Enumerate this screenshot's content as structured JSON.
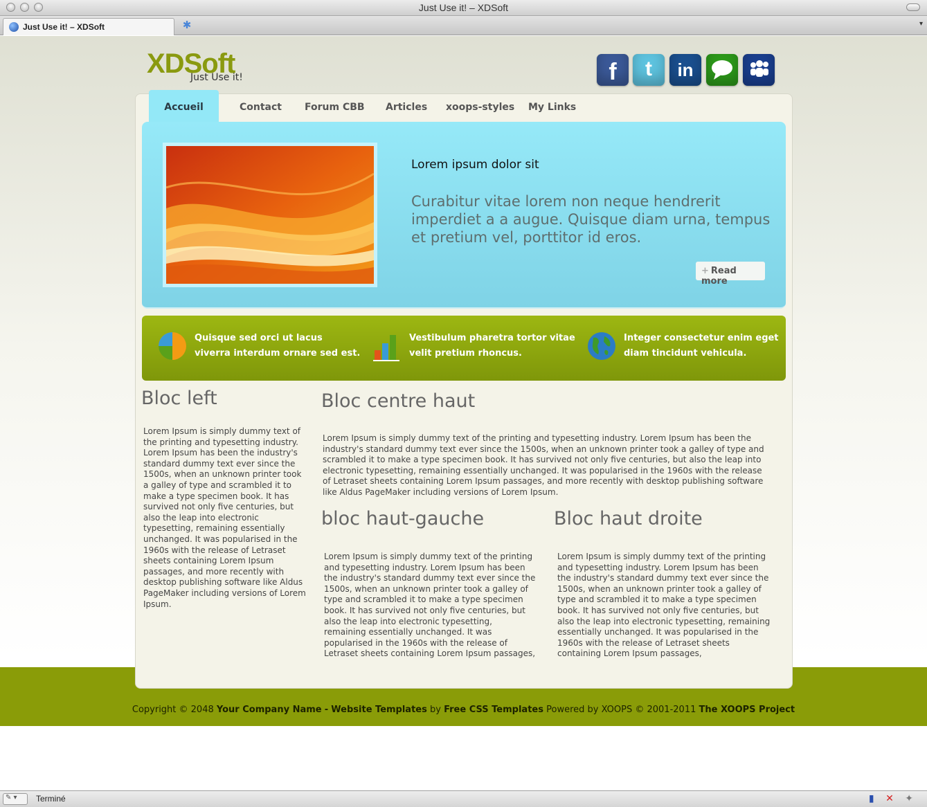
{
  "window": {
    "title": "Just Use it! – XDSoft",
    "tab_label": "Just Use it! – XDSoft"
  },
  "site": {
    "logo": "XDSoft",
    "tagline": "Just Use it!",
    "social": [
      {
        "name": "facebook",
        "glyph": "f",
        "color": "#3b5998"
      },
      {
        "name": "twitter",
        "glyph": "t",
        "color": "#5ec3df"
      },
      {
        "name": "linkedin",
        "glyph": "in",
        "color": "#1a4f8f"
      },
      {
        "name": "chat",
        "glyph": "",
        "color": "#2d9a1a"
      },
      {
        "name": "myspace",
        "glyph": "",
        "color": "#1a3f8f"
      }
    ]
  },
  "nav": {
    "items": [
      "Accueil",
      "Contact",
      "Forum CBB",
      "Articles",
      "xoops-styles",
      "My Links"
    ]
  },
  "hero": {
    "title": "Lorem ipsum dolor sit",
    "text": "Curabitur vitae lorem non neque hendrerit imperdiet a a augue. Quisque diam urna, tempus et pretium vel, porttitor id eros.",
    "read_more": "Read more"
  },
  "features": [
    {
      "icon": "pie-chart-icon",
      "text": "Quisque sed orci ut lacus viverra interdum ornare sed est."
    },
    {
      "icon": "bar-chart-icon",
      "text": "Vestibulum pharetra tortor vitae velit pretium rhoncus."
    },
    {
      "icon": "globe-icon",
      "text": "Integer consectetur enim eget diam tincidunt vehicula."
    }
  ],
  "blocks": {
    "left_title": "Bloc left",
    "left_text": "Lorem Ipsum is simply dummy text of the printing and typesetting industry. Lorem Ipsum has been the industry's standard dummy text ever since the 1500s, when an unknown printer took a galley of type and scrambled it to make a type specimen book. It has survived not only five centuries, but also the leap into electronic typesetting, remaining essentially unchanged. It was popularised in the 1960s with the release of Letraset sheets containing Lorem Ipsum passages, and more recently with desktop publishing software like Aldus PageMaker including versions of Lorem Ipsum.",
    "center_title": "Bloc centre haut",
    "center_text": "Lorem Ipsum is simply dummy text of the printing and typesetting industry. Lorem Ipsum has been the industry's standard dummy text ever since the 1500s, when an unknown printer took a galley of type and scrambled it to make a type specimen book. It has survived not only five centuries, but also the leap into electronic typesetting, remaining essentially unchanged. It was popularised in the 1960s with the release of Letraset sheets containing Lorem Ipsum passages, and more recently with desktop publishing software like Aldus PageMaker including versions of Lorem Ipsum.",
    "hg_title": "bloc haut-gauche",
    "hg_text": "Lorem Ipsum is simply dummy text of the printing and typesetting industry. Lorem Ipsum has been the industry's standard dummy text ever since the 1500s, when an unknown printer took a galley of type and scrambled it to make a type specimen book. It has survived not only five centuries, but also the leap into electronic typesetting, remaining essentially unchanged. It was popularised in the 1960s with the release of Letraset sheets containing Lorem Ipsum passages,",
    "hd_title": "Bloc haut droite",
    "hd_text": "Lorem Ipsum is simply dummy text of the printing and typesetting industry. Lorem Ipsum has been the industry's standard dummy text ever since the 1500s, when an unknown printer took a galley of type and scrambled it to make a type specimen book. It has survived not only five centuries, but also the leap into electronic typesetting, remaining essentially unchanged. It was popularised in the 1960s with the release of Letraset sheets containing Lorem Ipsum passages,"
  },
  "footer": {
    "copyright_prefix": "Copyright © 2048",
    "company": "Your Company Name",
    "dash": "-",
    "website_templates": "Website Templates",
    "by": "by",
    "free_css": "Free CSS Templates",
    "powered": "Powered by XOOPS © 2001-2011",
    "xoops_project": "The XOOPS Project"
  },
  "status": {
    "text": "Terminé"
  },
  "colors": {
    "accent_green": "#8a9c08",
    "hero_blue": "#93e8f7",
    "logo_green": "#8a9a10"
  }
}
